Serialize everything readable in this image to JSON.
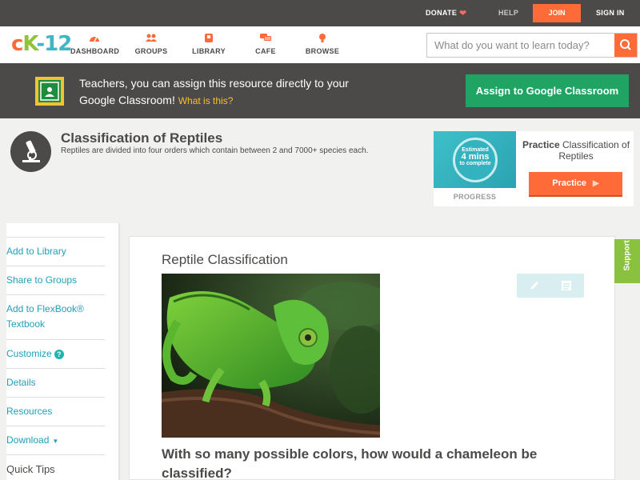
{
  "topbar": {
    "donate": "DONATE",
    "help": "HELP",
    "join": "JOIN",
    "signin": "SIGN IN"
  },
  "logo": {
    "c": "c",
    "k": "K",
    "n": "-12"
  },
  "nav": {
    "items": [
      {
        "label": "DASHBOARD",
        "icon": "dashboard-icon"
      },
      {
        "label": "GROUPS",
        "icon": "groups-icon"
      },
      {
        "label": "LIBRARY",
        "icon": "library-icon"
      },
      {
        "label": "CAFE",
        "icon": "cafe-icon"
      },
      {
        "label": "BROWSE",
        "icon": "browse-icon"
      }
    ]
  },
  "search": {
    "placeholder": "What do you want to learn today?"
  },
  "banner": {
    "text": "Teachers, you can assign this resource directly to your Google Classroom!",
    "link": "What is this?",
    "assign_button": "Assign to Google Classroom"
  },
  "concept": {
    "title": "Classification of Reptiles",
    "description": "Reptiles are divided into four orders which contain between 2 and 7000+ species each."
  },
  "practice": {
    "estimated": "Estimated",
    "minutes": "4 mins",
    "to_complete": "to complete",
    "progress_label": "PROGRESS",
    "heading_bold": "Practice",
    "heading_rest": "Classification of Reptiles",
    "button": "Practice"
  },
  "sidebar": {
    "items": [
      {
        "label": "Add to Library"
      },
      {
        "label": "Share to Groups"
      },
      {
        "label": "Add to FlexBook® Textbook"
      },
      {
        "label": "Customize"
      },
      {
        "label": "Details"
      },
      {
        "label": "Resources"
      },
      {
        "label": "Download"
      }
    ],
    "quick_tips": "Quick Tips"
  },
  "content": {
    "section_title": "Reptile Classification",
    "question": "With so many possible colors, how would a chameleon be classified?"
  },
  "support": {
    "label": "Support"
  },
  "colors": {
    "accent_orange": "#ff6a39",
    "brand_green": "#20a464",
    "link_teal": "#1f9fb8",
    "dark_bar": "#4b4a48"
  }
}
